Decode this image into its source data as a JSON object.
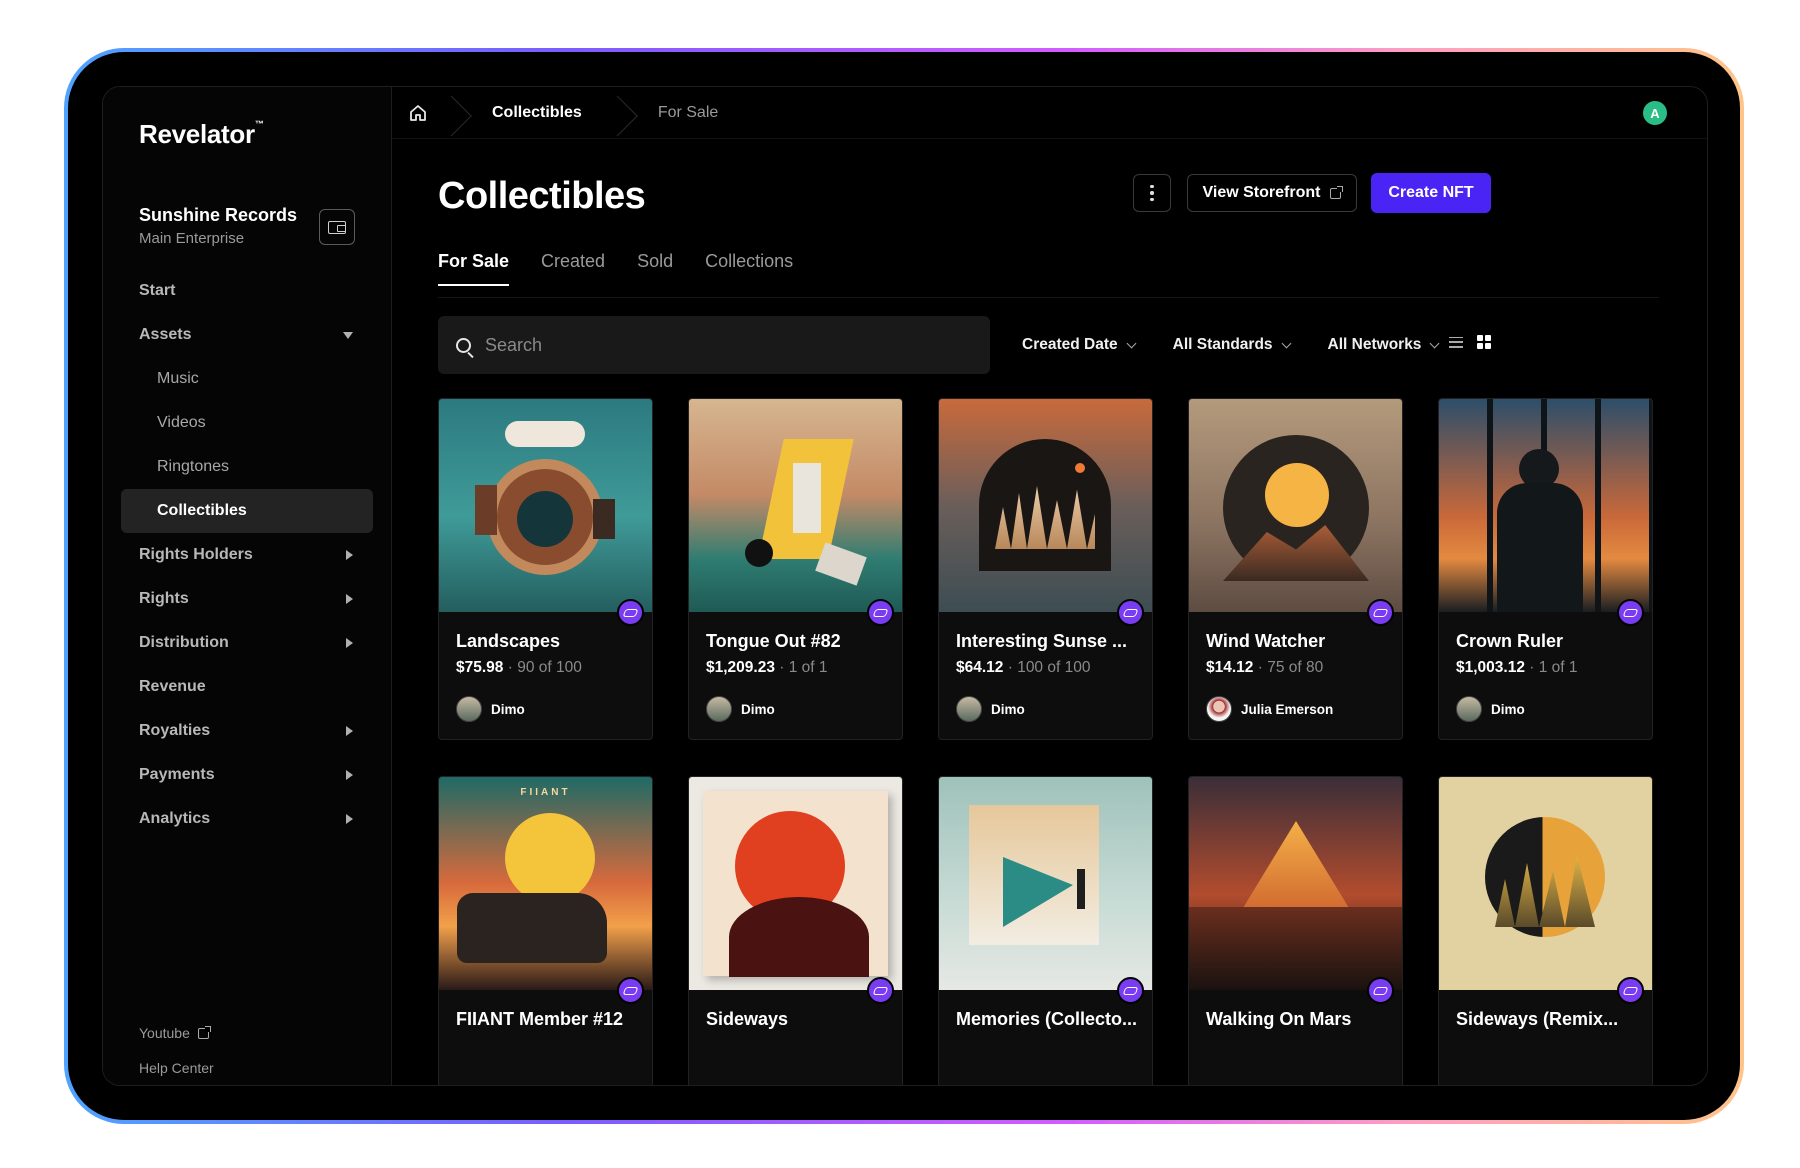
{
  "brand": {
    "name": "Revelator",
    "mark": "™"
  },
  "org": {
    "name": "Sunshine Records",
    "sub": "Main Enterprise"
  },
  "nav": {
    "start": "Start",
    "assets": "Assets",
    "music": "Music",
    "videos": "Videos",
    "ringtones": "Ringtones",
    "collectibles": "Collectibles",
    "rights_holders": "Rights Holders",
    "rights": "Rights",
    "distribution": "Distribution",
    "revenue": "Revenue",
    "royalties": "Royalties",
    "payments": "Payments",
    "analytics": "Analytics"
  },
  "footer": {
    "youtube": "Youtube",
    "help": "Help Center"
  },
  "breadcrumb": {
    "collectibles": "Collectibles",
    "for_sale": "For Sale"
  },
  "user": {
    "initial": "A"
  },
  "page": {
    "title": "Collectibles",
    "view_storefront": "View Storefront",
    "create_nft": "Create NFT"
  },
  "tabs": {
    "for_sale": "For Sale",
    "created": "Created",
    "sold": "Sold",
    "collections": "Collections"
  },
  "search": {
    "placeholder": "Search"
  },
  "filters": {
    "date": "Created Date",
    "standards": "All Standards",
    "networks": "All Networks"
  },
  "cards": [
    {
      "title": "Landscapes",
      "price": "$75.98",
      "edition": " · 90 of 100",
      "creator": "Dimo"
    },
    {
      "title": "Tongue Out #82",
      "price": "$1,209.23",
      "edition": " · 1 of 1",
      "creator": "Dimo"
    },
    {
      "title": "Interesting Sunse ...",
      "price": "$64.12",
      "edition": " · 100 of 100",
      "creator": "Dimo"
    },
    {
      "title": "Wind Watcher",
      "price": "$14.12",
      "edition": " · 75 of 80",
      "creator": "Julia Emerson"
    },
    {
      "title": "Crown Ruler",
      "price": "$1,003.12",
      "edition": " · 1 of 1",
      "creator": "Dimo"
    },
    {
      "title": "FIIANT Member #12"
    },
    {
      "title": "Sideways"
    },
    {
      "title": "Memories (Collecto..."
    },
    {
      "title": "Walking On Mars"
    },
    {
      "title": "Sideways (Remix..."
    }
  ],
  "art_text": {
    "fiiant": "FIIANT"
  }
}
